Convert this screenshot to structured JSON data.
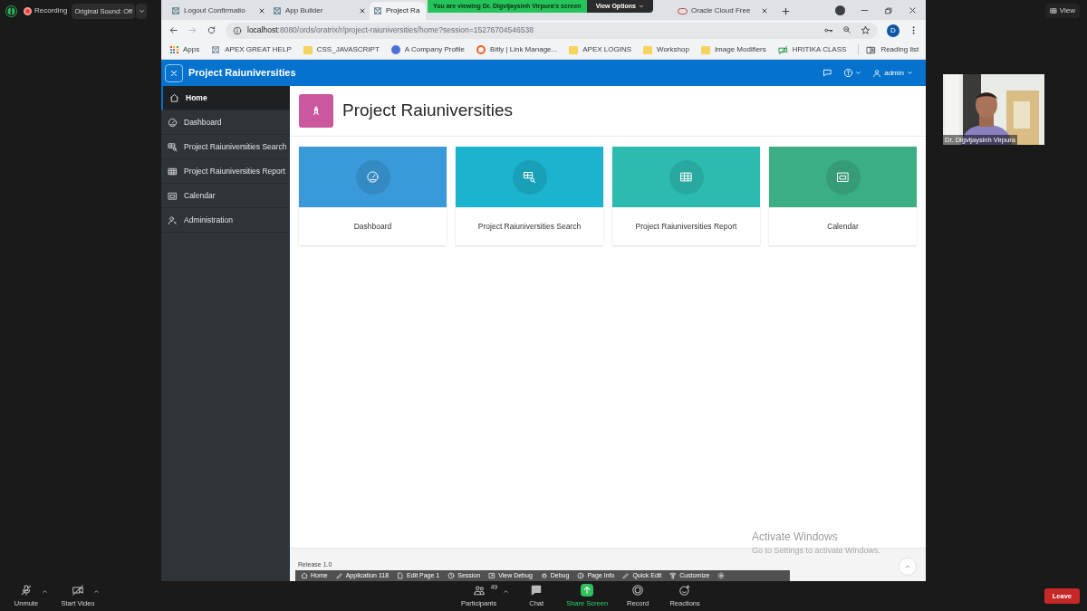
{
  "zoom_top": {
    "recording": "Recording",
    "original_sound": "Original Sound: Off",
    "view": "View"
  },
  "share_banner": {
    "text": "You are viewing Dr. Digvijaysinh Virpura's screen",
    "options": "View Options"
  },
  "browser": {
    "tabs": [
      {
        "title": "Logout Confirmatio",
        "selected": false,
        "kind": "apex"
      },
      {
        "title": "App Builder",
        "selected": false,
        "kind": "apex"
      },
      {
        "title": "Project Ra",
        "selected": true,
        "kind": "apex"
      },
      {
        "title": "Oracle Cloud Free",
        "selected": false,
        "kind": "oracle"
      }
    ],
    "url": {
      "host": "localhost",
      "path": ":8080/ords/oratrix/r/project-raiuniversities/home?session=15276704546538"
    },
    "profile_initial": "D",
    "bookmarks": [
      {
        "label": "Apps",
        "kind": "apps"
      },
      {
        "label": "APEX GREAT HELP",
        "kind": "apex"
      },
      {
        "label": "CSS_JAVASCRIPT",
        "kind": "folder"
      },
      {
        "label": "A Company Profile",
        "kind": "profile"
      },
      {
        "label": "Bitly | Link Manage...",
        "kind": "bitly"
      },
      {
        "label": "APEX LOGINS",
        "kind": "folder"
      },
      {
        "label": "Workshop",
        "kind": "folder"
      },
      {
        "label": "Image Modifiers",
        "kind": "folder"
      },
      {
        "label": "HRITIKA CLASS",
        "kind": "meet"
      }
    ],
    "reading_list": "Reading list"
  },
  "app": {
    "title": "Project Raiuniversities",
    "user": "admin",
    "nav": [
      {
        "label": "Home",
        "selected": true
      },
      {
        "label": "Dashboard",
        "selected": false
      },
      {
        "label": "Project Raiuniversities Search",
        "selected": false
      },
      {
        "label": "Project Raiuniversities Report",
        "selected": false
      },
      {
        "label": "Calendar",
        "selected": false
      },
      {
        "label": "Administration",
        "selected": false
      }
    ],
    "page_title": "Project Raiuniversities",
    "cards": [
      {
        "label": "Dashboard",
        "color": "#3a9ad9"
      },
      {
        "label": "Project Raiuniversities Search",
        "color": "#1cb3cf"
      },
      {
        "label": "Project Raiuniversities Report",
        "color": "#2dbbb0"
      },
      {
        "label": "Calendar",
        "color": "#3bae83"
      }
    ],
    "release": "Release 1.0",
    "dev_toolbar": [
      "Home",
      "Application 118",
      "Edit Page 1",
      "Session",
      "View Debug",
      "Debug",
      "Page Info",
      "Quick Edit",
      "Customize"
    ]
  },
  "windows_notice": {
    "title": "Activate Windows",
    "subtitle": "Go to Settings to activate Windows."
  },
  "participant": {
    "name": "Dr. Digvijaysinh Virpura"
  },
  "zoom_toolbar": {
    "left": [
      "Unmute",
      "Start Video"
    ],
    "participants_count": "49",
    "center": [
      "Participants",
      "Chat",
      "Share Screen",
      "Record",
      "Reactions"
    ],
    "leave": "Leave"
  }
}
